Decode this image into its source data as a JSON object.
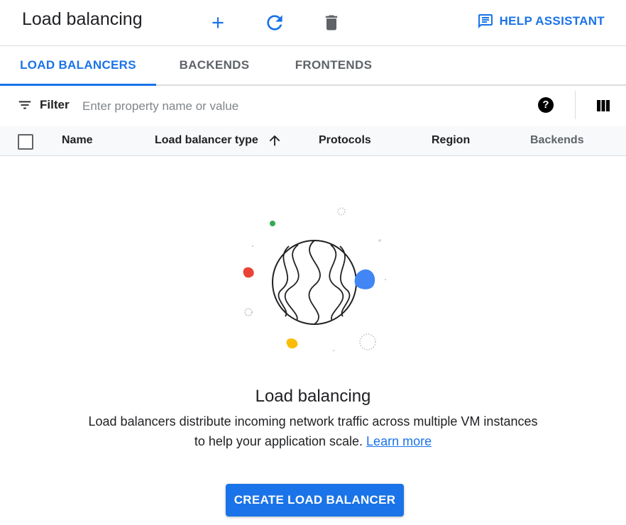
{
  "header": {
    "title": "Load balancing",
    "help_label": "HELP ASSISTANT"
  },
  "toolbar": {
    "add_icon": "plus-icon",
    "refresh_icon": "refresh-icon",
    "delete_icon": "trash-icon"
  },
  "tabs": [
    {
      "label": "LOAD BALANCERS",
      "active": true
    },
    {
      "label": "BACKENDS",
      "active": false
    },
    {
      "label": "FRONTENDS",
      "active": false
    }
  ],
  "filter": {
    "label": "Filter",
    "placeholder": "Enter property name or value"
  },
  "table": {
    "columns": [
      "Name",
      "Load balancer type",
      "Protocols",
      "Region",
      "Backends"
    ],
    "sorted_column": "Load balancer type",
    "sort_direction": "ascending"
  },
  "empty_state": {
    "title": "Load balancing",
    "line1": "Load balancers distribute incoming network traffic across multiple VM instances",
    "line2": "to help your application scale.",
    "link": "Learn more",
    "button": "CREATE LOAD BALANCER"
  },
  "colors": {
    "accent": "#1a73e8",
    "dot_red": "#ea4335",
    "dot_yellow": "#fbbc04",
    "dot_green": "#34a853",
    "dot_blue": "#4285f4"
  }
}
